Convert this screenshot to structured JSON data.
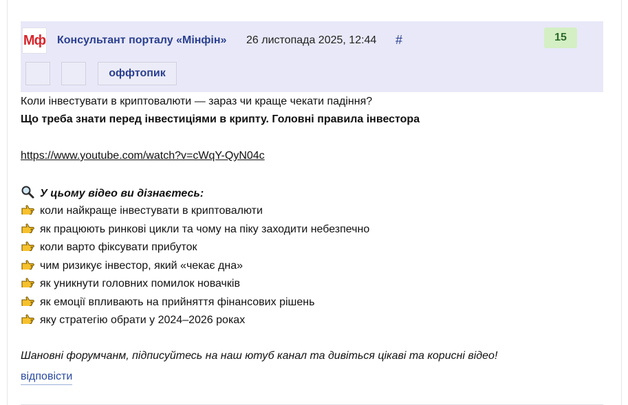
{
  "post": {
    "avatar_text": "Мф",
    "author": "Консультант порталу «Мінфін»",
    "date": "26 листопада 2025, 12:44",
    "permalink": "#",
    "score": "15",
    "tag": "оффтопик"
  },
  "content": {
    "line1": "Коли інвестувати в криптовалюти — зараз чи краще чекати падіння?",
    "line2": "Що треба знати перед інвестиціями в крипту. Головні правила інвестора",
    "link": "https://www.youtube.com/watch?v=cWqY-QyN04c",
    "heading": "У цьому відео ви дізнаєтесь:",
    "bullets": [
      "коли найкраще інвестувати в криптовалюти",
      "як працюють ринкові цикли та чому на піку заходити небезпечно",
      "коли варто фіксувати прибуток",
      "чим ризикує інвестор, який «чекає дна»",
      "як уникнути головних помилок новачків",
      "як емоції впливають на прийняття фінансових рішень",
      "яку стратегію обрати у 2024–2026 роках"
    ],
    "closing": "Шановні форумчанм, підписуйтесь на наш ютуб канал та дивіться цікаві та корисні відео!"
  },
  "actions": {
    "reply": "відповісти"
  },
  "icons": {
    "heading_icon": "magnifier-icon",
    "bullet_icon": "pointing-hand-icon"
  }
}
